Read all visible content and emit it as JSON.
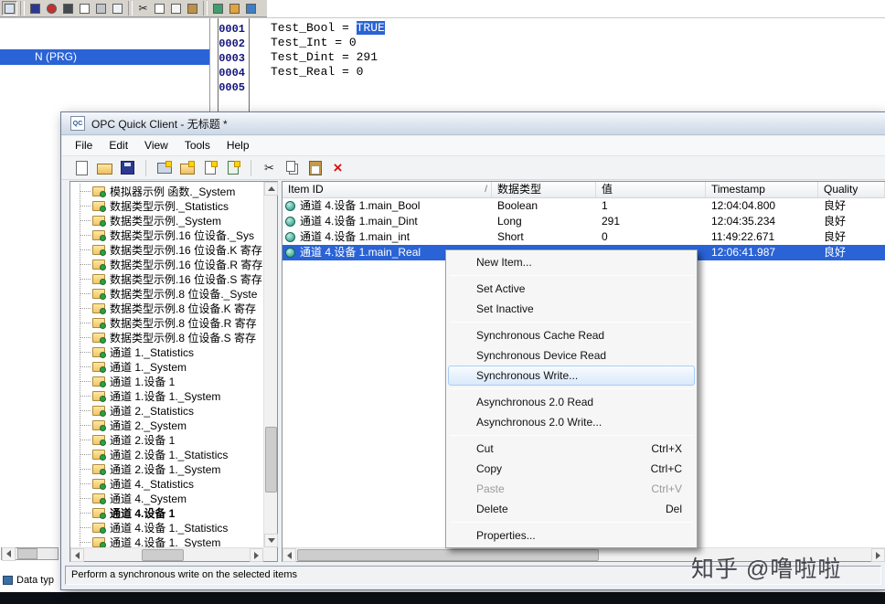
{
  "background_app": {
    "toolbar_icons": [
      {
        "name": "project-window-icon",
        "color": "#d9e4f2",
        "pressed": true
      },
      {
        "separator": true
      },
      {
        "name": "save-icon",
        "color": "#2b3990"
      },
      {
        "name": "stop-icon",
        "color": "#c43030",
        "shape": "circle"
      },
      {
        "name": "glasses-icon",
        "color": "#444a52"
      },
      {
        "name": "document-icon",
        "color": "#ffffff"
      },
      {
        "name": "print-icon",
        "color": "#bfc4c9"
      },
      {
        "name": "preview-icon",
        "color": "#eef2f7"
      },
      {
        "separator": true
      },
      {
        "name": "cut-icon",
        "char": "✂"
      },
      {
        "name": "copy-icon",
        "color": "#ffffff"
      },
      {
        "name": "copy-pages-icon",
        "color": "#f4f4f4"
      },
      {
        "name": "paste-icon",
        "color": "#bd9147"
      },
      {
        "separator": true
      },
      {
        "name": "grid-icon",
        "color": "#3f9d6e"
      },
      {
        "name": "edit-icon",
        "color": "#e2a23c"
      },
      {
        "name": "monitor-icon",
        "color": "#3f7ec4"
      }
    ],
    "project_panel": {
      "selected_item": "N (PRG)"
    },
    "editor": {
      "line_numbers": [
        "0001",
        "0002",
        "0003",
        "0004",
        "0005"
      ],
      "code_lines": [
        {
          "pre": "Test_Bool = ",
          "sel": "TRUE"
        },
        {
          "pre": "Test_Int = 0",
          "sel": ""
        },
        {
          "pre": "Test_Dint = 291",
          "sel": ""
        },
        {
          "pre": "Test_Real = 0",
          "sel": ""
        }
      ]
    },
    "bottom_tab_label": "Data typ"
  },
  "opc_window": {
    "title": "OPC Quick Client - 无标题 *",
    "title_icon_text": "QC",
    "menu": [
      "File",
      "Edit",
      "View",
      "Tools",
      "Help"
    ],
    "toolbar_icons": [
      {
        "name": "new-icon",
        "key": "new"
      },
      {
        "name": "open-icon",
        "key": "open"
      },
      {
        "name": "save-icon",
        "key": "save"
      },
      {
        "separator": true
      },
      {
        "name": "new-server-icon",
        "key": "server"
      },
      {
        "name": "new-group-icon",
        "key": "group"
      },
      {
        "name": "new-item-icon",
        "key": "item"
      },
      {
        "name": "clone-item-icon",
        "key": "clone"
      },
      {
        "separator": true
      },
      {
        "name": "cut-icon",
        "key": "cut"
      },
      {
        "name": "copy-icon",
        "key": "copy"
      },
      {
        "name": "paste-icon",
        "key": "paste"
      },
      {
        "name": "delete-icon",
        "key": "delete"
      }
    ],
    "tree": {
      "items": [
        "模拟器示例 函数._System",
        "数据类型示例._Statistics",
        "数据类型示例._System",
        "数据类型示例.16 位设备._Sys",
        "数据类型示例.16 位设备.K 寄存",
        "数据类型示例.16 位设备.R 寄存",
        "数据类型示例.16 位设备.S 寄存",
        "数据类型示例.8 位设备._Syste",
        "数据类型示例.8 位设备.K 寄存",
        "数据类型示例.8 位设备.R 寄存",
        "数据类型示例.8 位设备.S 寄存",
        "通道 1._Statistics",
        "通道 1._System",
        "通道 1.设备 1",
        "通道 1.设备 1._System",
        "通道 2._Statistics",
        "通道 2._System",
        "通道 2.设备 1",
        "通道 2.设备 1._Statistics",
        "通道 2.设备 1._System",
        "通道 4._Statistics",
        "通道 4._System",
        "通道 4.设备 1",
        "通道 4.设备 1._Statistics",
        "通道 4.设备 1._System"
      ],
      "selected_item": "通道 4.设备 1"
    },
    "list": {
      "columns": [
        "Item ID",
        "数据类型",
        "值",
        "Timestamp",
        "Quality"
      ],
      "sort_char": "/",
      "rows": [
        {
          "id": "通道 4.设备 1.main_Bool",
          "type": "Boolean",
          "value": "1",
          "timestamp": "12:04:04.800",
          "quality": "良好",
          "selected": false
        },
        {
          "id": "通道 4.设备 1.main_Dint",
          "type": "Long",
          "value": "291",
          "timestamp": "12:04:35.234",
          "quality": "良好",
          "selected": false
        },
        {
          "id": "通道 4.设备 1.main_int",
          "type": "Short",
          "value": "0",
          "timestamp": "11:49:22.671",
          "quality": "良好",
          "selected": false
        },
        {
          "id": "通道 4.设备 1.main_Real",
          "type": "",
          "value": "",
          "timestamp": "12:06:41.987",
          "quality": "良好",
          "selected": true
        }
      ]
    },
    "status_text": "Perform a synchronous write on the selected items"
  },
  "context_menu": {
    "items": [
      {
        "label": "New Item..."
      },
      {
        "separator": true
      },
      {
        "label": "Set Active"
      },
      {
        "label": "Set Inactive"
      },
      {
        "separator": true
      },
      {
        "label": "Synchronous Cache Read"
      },
      {
        "label": "Synchronous Device Read"
      },
      {
        "label": "Synchronous Write...",
        "state": "highlighted"
      },
      {
        "separator": true
      },
      {
        "label": "Asynchronous 2.0 Read"
      },
      {
        "label": "Asynchronous 2.0 Write..."
      },
      {
        "separator": true
      },
      {
        "label": "Cut",
        "shortcut": "Ctrl+X"
      },
      {
        "label": "Copy",
        "shortcut": "Ctrl+C"
      },
      {
        "label": "Paste",
        "shortcut": "Ctrl+V",
        "state": "disabled"
      },
      {
        "label": "Delete",
        "shortcut": "Del"
      },
      {
        "separator": true
      },
      {
        "label": "Properties..."
      }
    ]
  },
  "watermark": "知乎 @噜啦啦"
}
